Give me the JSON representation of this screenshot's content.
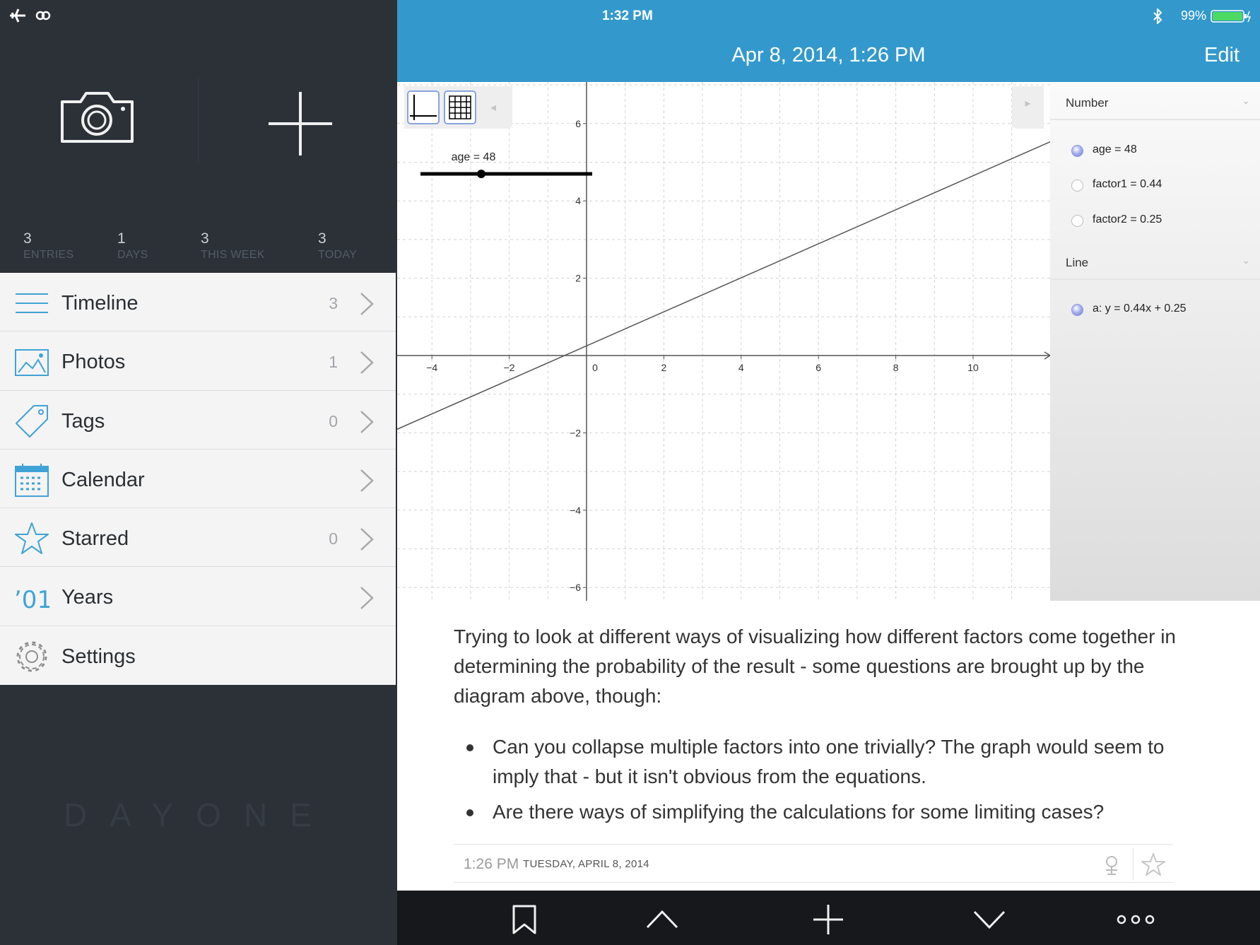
{
  "status_bar": {
    "time": "1:32 PM",
    "battery": "99%"
  },
  "sidebar": {
    "stats": [
      {
        "value": "3",
        "label": "ENTRIES"
      },
      {
        "value": "1",
        "label": "DAYS"
      },
      {
        "value": "3",
        "label": "THIS WEEK"
      },
      {
        "value": "3",
        "label": "TODAY"
      }
    ],
    "items": [
      {
        "label": "Timeline",
        "count": "3",
        "icon": "timeline-icon"
      },
      {
        "label": "Photos",
        "count": "1",
        "icon": "photos-icon"
      },
      {
        "label": "Tags",
        "count": "0",
        "icon": "tag-icon"
      },
      {
        "label": "Calendar",
        "count": "",
        "icon": "calendar-icon"
      },
      {
        "label": "Starred",
        "count": "0",
        "icon": "star-icon"
      },
      {
        "label": "Years",
        "count": "",
        "icon": "years-icon"
      },
      {
        "label": "Settings",
        "count": "",
        "icon": "gear-icon"
      }
    ],
    "logo": "DAYONE"
  },
  "header": {
    "title": "Apr 8, 2014, 1:26 PM",
    "edit_label": "Edit"
  },
  "geogebra": {
    "slider_label": "age = 48",
    "algebra": {
      "number_header": "Number",
      "numbers": [
        "age = 48",
        "factor1 = 0.44",
        "factor2 = 0.25"
      ],
      "line_header": "Line",
      "lines": [
        "a: y = 0.44x + 0.25"
      ]
    }
  },
  "chart_data": {
    "type": "line",
    "title": "",
    "xlabel": "",
    "ylabel": "",
    "xlim": [
      -4.6,
      12.2
    ],
    "ylim": [
      -6.6,
      7.0
    ],
    "x_ticks": [
      -4,
      -2,
      0,
      2,
      4,
      6,
      8,
      10
    ],
    "y_ticks": [
      -6,
      -4,
      -2,
      2,
      4,
      6
    ],
    "grid": true,
    "series": [
      {
        "name": "a",
        "equation": "y = 0.44x + 0.25",
        "slope": 0.44,
        "intercept": 0.25,
        "color": "#555555"
      }
    ],
    "slider": {
      "name": "age",
      "value": 48
    }
  },
  "entry": {
    "paragraph": "Trying to look at different ways of visualizing how different factors come together in determining the probability of the result - some questions are brought up by the diagram above, though:",
    "bullets": [
      "Can you collapse multiple factors into one trivially? The graph would seem to imply that - but it isn't obvious from the equations.",
      "Are there ways of simplifying the calculations for some limiting cases?"
    ],
    "time": "1:26 PM",
    "date": "TUESDAY, APRIL 8, 2014"
  },
  "colors": {
    "accent": "#3399cc",
    "sidebar_bg": "#2c3138",
    "menu_icon": "#3fa3d6",
    "toolbar_bg": "#16181b"
  }
}
